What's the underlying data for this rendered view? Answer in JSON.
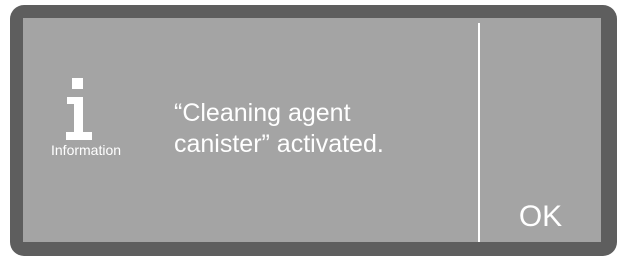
{
  "dialog": {
    "icon": "information-icon",
    "icon_label": "Information",
    "message": "“Cleaning agent\ncanister” activated.",
    "ok_label": "OK"
  },
  "colors": {
    "bezel": "#5e5e5e",
    "screen": "#a4a4a4",
    "text": "#ffffff"
  }
}
